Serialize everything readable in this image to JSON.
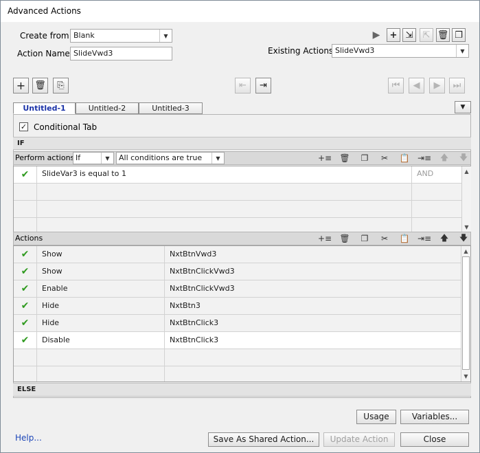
{
  "window": {
    "title": "Advanced Actions"
  },
  "form": {
    "create_from_label": "Create from:",
    "create_from_value": "Blank",
    "action_name_label": "Action Name:",
    "action_name_value": "SlideVwd3",
    "existing_actions_label": "Existing Actions:",
    "existing_actions_value": "SlideVwd3"
  },
  "tabs": [
    {
      "label": "Untitled-1",
      "active": true
    },
    {
      "label": "Untitled-2",
      "active": false
    },
    {
      "label": "Untitled-3",
      "active": false
    }
  ],
  "conditional_tab": {
    "label": "Conditional Tab",
    "checked": true
  },
  "if_section": {
    "label": "IF",
    "perform_actions_label": "Perform actions:",
    "perform_actions_value": "If",
    "conditions_value": "All conditions are true",
    "conditions": [
      {
        "variable": "SlideVar3",
        "operator": "is equal to",
        "value": "1",
        "logic": "AND"
      }
    ]
  },
  "actions_section": {
    "label": "Actions",
    "rows": [
      {
        "action": "Show",
        "target": "NxtBtnVwd3"
      },
      {
        "action": "Show",
        "target": "NxtBtnClickVwd3"
      },
      {
        "action": "Enable",
        "target": "NxtBtnClickVwd3"
      },
      {
        "action": "Hide",
        "target": "NxtBtn3"
      },
      {
        "action": "Hide",
        "target": "NxtBtnClick3"
      },
      {
        "action": "Disable",
        "target": "NxtBtnClick3"
      }
    ]
  },
  "else_section": {
    "label": "ELSE"
  },
  "buttons": {
    "usage": "Usage",
    "variables": "Variables...",
    "help": "Help...",
    "save_shared": "Save As Shared Action...",
    "update_action": "Update Action",
    "close": "Close"
  },
  "colors": {
    "check": "#2f9a1f",
    "active_tab": "#1a32a8",
    "link": "#1d46b8"
  }
}
